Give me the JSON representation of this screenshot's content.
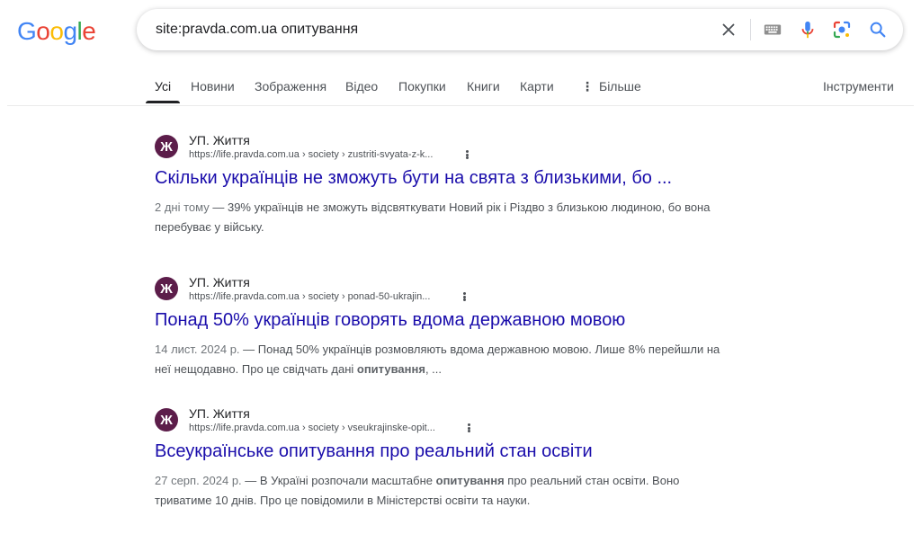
{
  "logo": {
    "letters": [
      "G",
      "o",
      "o",
      "g",
      "l",
      "e"
    ]
  },
  "search": {
    "query": "site:pravda.com.ua опитування",
    "icons": [
      "close-icon",
      "keyboard-icon",
      "mic-icon",
      "lens-icon",
      "search-icon"
    ]
  },
  "tabs": [
    {
      "label": "Усі",
      "active": true
    },
    {
      "label": "Новини"
    },
    {
      "label": "Зображення"
    },
    {
      "label": "Відео"
    },
    {
      "label": "Покупки"
    },
    {
      "label": "Книги"
    },
    {
      "label": "Карти"
    },
    {
      "label": "Більше"
    },
    {
      "label": "Інструменти"
    }
  ],
  "results": [
    {
      "favicon_letter": "Ж",
      "site_name": "УП. Життя",
      "url": "https://life.pravda.com.ua › society › zustriti-svyata-z-k...",
      "title": "Скільки українців не зможуть бути на свята з близькими, бо ...",
      "date": "2 дні тому",
      "snippet_1": " — 39% українців не зможуть відсвяткувати Новий рік і Різдво з близькою людиною, бо вона перебуває у війську."
    },
    {
      "favicon_letter": "Ж",
      "site_name": "УП. Життя",
      "url": "https://life.pravda.com.ua › society › ponad-50-ukrajin...",
      "title": "Понад 50% українців говорять вдома державною мовою",
      "date": "14 лист. 2024 р.",
      "snippet_1": " — Понад 50% українців розмовляють вдома державною мовою. Лише 8% перейшли на неї нещодавно. Про це свідчать дані ",
      "snippet_bold": "опитування",
      "snippet_2": ", ..."
    },
    {
      "favicon_letter": "Ж",
      "site_name": "УП. Життя",
      "url": "https://life.pravda.com.ua › society › vseukrajinske-opit...",
      "title": "Всеукраїнське опитування про реальний стан освіти",
      "date": "27 серп. 2024 р.",
      "snippet_1": " — В Україні розпочали масштабне ",
      "snippet_bold": "опитування",
      "snippet_2": " про реальний стан освіти. Воно триватиме 10 днів. Про це повідомили в Міністерстві освіти та науки."
    }
  ],
  "colors": {
    "link": "#1a0dab",
    "favicon_bg": "#5c1d4a",
    "google_blue": "#4285f4",
    "google_red": "#ea4335",
    "google_yellow": "#fbbc05",
    "google_green": "#34a853"
  }
}
